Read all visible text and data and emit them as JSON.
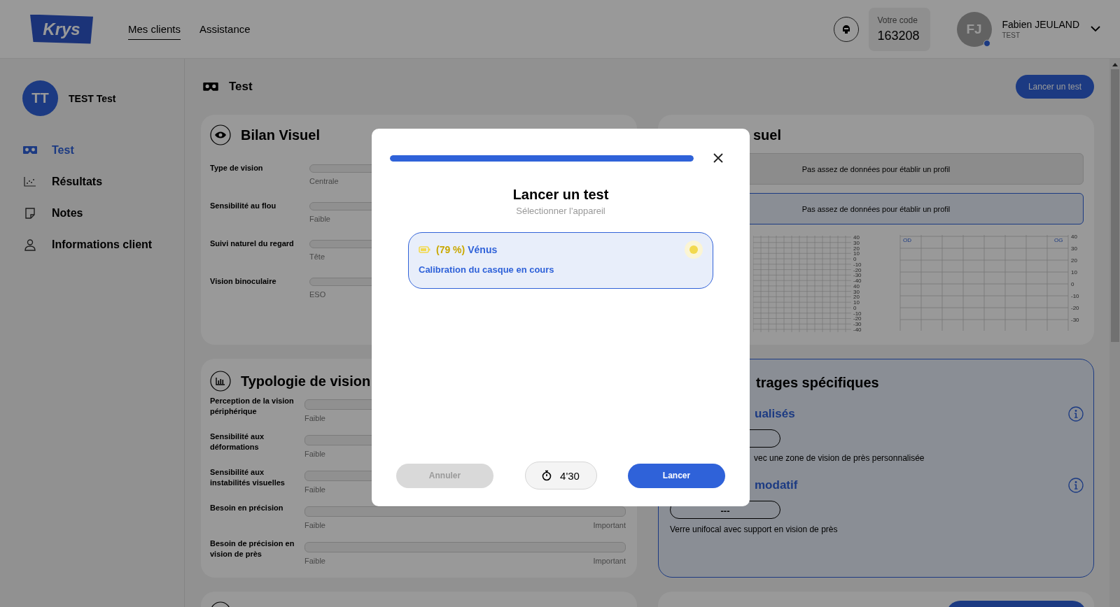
{
  "header": {
    "logo": "Krys",
    "nav": [
      {
        "label": "Mes clients",
        "selected": true
      },
      {
        "label": "Assistance",
        "selected": false
      }
    ],
    "code_label": "Votre code",
    "code": "163208",
    "user": {
      "initials": "FJ",
      "name": "Fabien JEULAND",
      "role": "TEST",
      "online": true
    }
  },
  "sidebar": {
    "client": {
      "initials": "TT",
      "name": "TEST Test"
    },
    "items": [
      {
        "label": "Test",
        "kind": "goggles",
        "selected": true
      },
      {
        "label": "Résultats",
        "kind": "scatter",
        "selected": false
      },
      {
        "label": "Notes",
        "kind": "note",
        "selected": false
      },
      {
        "label": "Informations client",
        "kind": "person",
        "selected": false
      }
    ]
  },
  "page": {
    "title": "Test",
    "action": "Lancer un test"
  },
  "bilan": {
    "title": "Bilan Visuel",
    "rows": [
      {
        "label": "Type de vision",
        "low": "Centrale"
      },
      {
        "label": "Sensibilité au flou",
        "low": "Faible"
      },
      {
        "label": "Suivi naturel du regard",
        "low": "Tête"
      },
      {
        "label": "Vision binoculaire",
        "low": "ESO"
      }
    ]
  },
  "profile": {
    "title": "suel",
    "notices": [
      {
        "text": "Pas assez de données pour établir un profil",
        "selected": false
      },
      {
        "text": "Pas assez de données pour établir un profil",
        "selected": true
      }
    ],
    "charts": [
      {
        "kind": "double",
        "ticks": [
          "40",
          "30",
          "20",
          "10",
          "0",
          "-10",
          "-20",
          "-30",
          "-40",
          "40",
          "30",
          "20",
          "10",
          "0",
          "-10",
          "-20",
          "-30",
          "-40"
        ]
      },
      {
        "kind": "single",
        "corners": [
          "OD",
          "OG"
        ],
        "ticks": [
          "40",
          "30",
          "20",
          "10",
          "0",
          "-10",
          "-20",
          "-30"
        ]
      }
    ]
  },
  "typologie": {
    "title": "Typologie de vision",
    "rows": [
      {
        "label": "Perception de la vision périphérique",
        "low": "Faible"
      },
      {
        "label": "Sensibilité aux déformations",
        "low": "Faible"
      },
      {
        "label": "Sensibilité aux instabilités visuelles",
        "low": "Faible"
      },
      {
        "label": "Besoin en précision",
        "low": "Faible",
        "high": "Important"
      },
      {
        "label": "Besoin de précision en vision de près",
        "low": "Faible",
        "high": "Important"
      }
    ]
  },
  "specific": {
    "title": "trages spécifiques",
    "sections": [
      {
        "title": "ualisés",
        "desc": "vec une zone de vision de près personnalisée"
      },
      {
        "title": "modatif",
        "value": "---",
        "desc": "Verre unifocal avec support en vision de près"
      }
    ]
  },
  "modal": {
    "level": 1,
    "title": "Lancer un test",
    "subtitle": "Sélectionner l'appareil",
    "devices": [
      {
        "battery": "(79 %)",
        "name": "Vénus",
        "status": "Calibration du casque en cours",
        "selected": true,
        "color": "#f2d94e"
      }
    ],
    "cancel": {
      "label": "Annuler",
      "disabled": true
    },
    "duration": "4'30",
    "confirm": "Lancer"
  }
}
